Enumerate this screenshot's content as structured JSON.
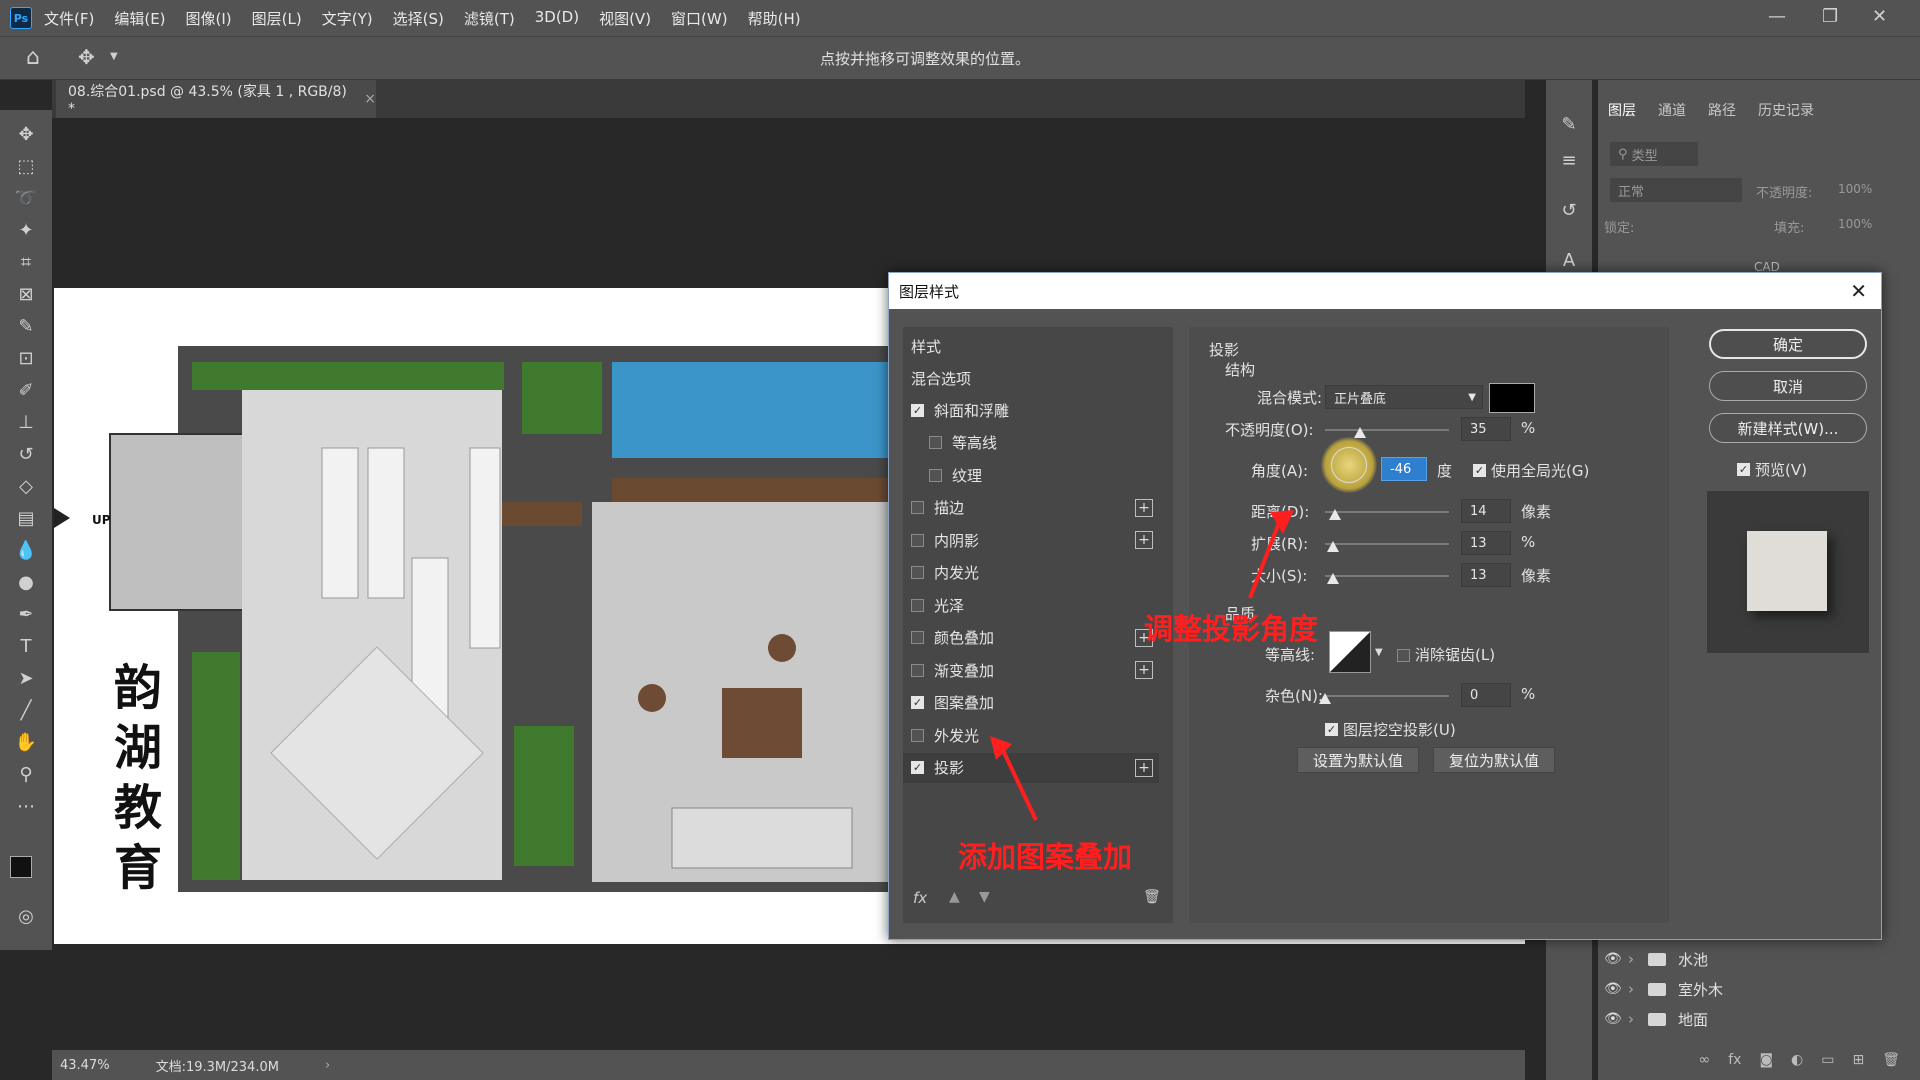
{
  "app": {
    "logo": "Ps",
    "menu": [
      "文件(F)",
      "编辑(E)",
      "图像(I)",
      "图层(L)",
      "文字(Y)",
      "选择(S)",
      "滤镜(T)",
      "3D(D)",
      "视图(V)",
      "窗口(W)",
      "帮助(H)"
    ],
    "hint": "点按并拖移可调整效果的位置。"
  },
  "document": {
    "tab_title": "08.综合01.psd @ 43.5% (家具 1 , RGB/8) *",
    "zoom": "43.47%",
    "doc_size": "文档:19.3M/234.0M",
    "canvas_text": {
      "up": "UP",
      "brand": [
        "韵",
        "湖",
        "教",
        "育"
      ]
    }
  },
  "panel": {
    "tabs": [
      "图层",
      "通道",
      "路径",
      "历史记录"
    ],
    "filter_kind": "类型",
    "blend": "正常",
    "opacity_label": "不透明度:",
    "opacity_value": "100%",
    "lock_label": "锁定:",
    "fill_label": "填充:",
    "fill_value": "100%",
    "top_layer": "CAD",
    "layers": [
      "水池",
      "室外木",
      "地面"
    ]
  },
  "dialog": {
    "title": "图层样式",
    "styles_header": "样式",
    "blend_options": "混合选项",
    "items": [
      {
        "label": "斜面和浮雕",
        "checked": true,
        "indent": false,
        "plus": false
      },
      {
        "label": "等高线",
        "checked": false,
        "indent": true,
        "plus": false
      },
      {
        "label": "纹理",
        "checked": false,
        "indent": true,
        "plus": false
      },
      {
        "label": "描边",
        "checked": false,
        "indent": false,
        "plus": true
      },
      {
        "label": "内阴影",
        "checked": false,
        "indent": false,
        "plus": true
      },
      {
        "label": "内发光",
        "checked": false,
        "indent": false,
        "plus": false
      },
      {
        "label": "光泽",
        "checked": false,
        "indent": false,
        "plus": false
      },
      {
        "label": "颜色叠加",
        "checked": false,
        "indent": false,
        "plus": true
      },
      {
        "label": "渐变叠加",
        "checked": false,
        "indent": false,
        "plus": true
      },
      {
        "label": "图案叠加",
        "checked": true,
        "indent": false,
        "plus": false
      },
      {
        "label": "外发光",
        "checked": false,
        "indent": false,
        "plus": false
      },
      {
        "label": "投影",
        "checked": true,
        "indent": false,
        "plus": true
      }
    ],
    "section": "投影",
    "structure": "结构",
    "blend_mode_label": "混合模式:",
    "blend_mode_value": "正片叠底",
    "shadow_color": "#000000",
    "opacity_label": "不透明度(O):",
    "opacity_value": "35",
    "opacity_unit": "%",
    "angle_label": "角度(A):",
    "angle_value": "-46",
    "angle_unit": "度",
    "global_light": "使用全局光(G)",
    "global_light_checked": true,
    "distance_label": "距离(D):",
    "distance_value": "14",
    "px_unit": "像素",
    "spread_label": "扩展(R):",
    "spread_value": "13",
    "size_label": "大小(S):",
    "size_value": "13",
    "quality": "品质",
    "contour_label": "等高线:",
    "antialias": "消除锯齿(L)",
    "noise_label": "杂色(N):",
    "noise_value": "0",
    "knockout": "图层挖空投影(U)",
    "knockout_checked": true,
    "set_default": "设置为默认值",
    "reset_default": "复位为默认值",
    "ok": "确定",
    "cancel": "取消",
    "new_style": "新建样式(W)...",
    "preview": "预览(V)",
    "preview_checked": true
  },
  "annotations": {
    "angle_note": "调整投影角度",
    "pattern_note": "添加图案叠加"
  },
  "colors": {
    "accent": "#31a8ff",
    "annotation": "#ff1f1f",
    "ui_bg": "#535353"
  }
}
